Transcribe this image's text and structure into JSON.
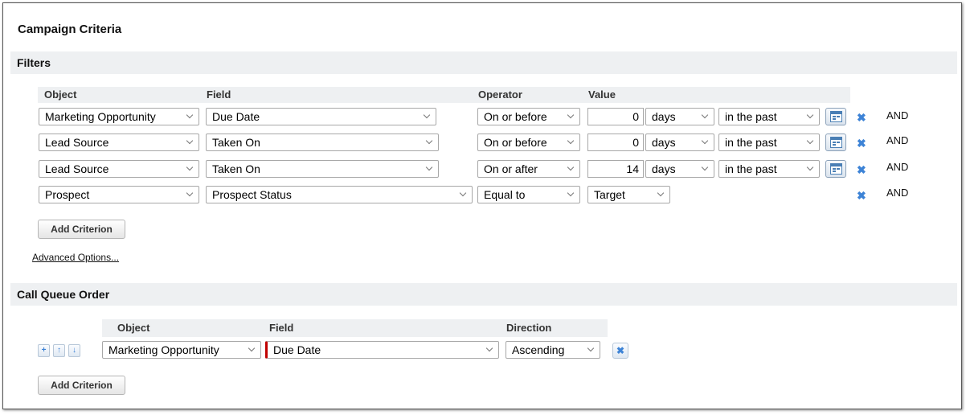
{
  "title": "Campaign Criteria",
  "filters": {
    "section_label": "Filters",
    "headers": {
      "object": "Object",
      "field": "Field",
      "operator": "Operator",
      "value": "Value"
    },
    "rows": [
      {
        "object": "Marketing Opportunity",
        "field": "Due Date",
        "operator": "On or before",
        "amount": "0",
        "unit": "days",
        "timeframe": "in the past",
        "logic": "AND"
      },
      {
        "object": "Lead Source",
        "field": "Taken On",
        "operator": "On or before",
        "amount": "0",
        "unit": "days",
        "timeframe": "in the past",
        "logic": "AND"
      },
      {
        "object": "Lead Source",
        "field": "Taken On",
        "operator": "On or after",
        "amount": "14",
        "unit": "days",
        "timeframe": "in the past",
        "logic": "AND"
      },
      {
        "object": "Prospect",
        "field": "Prospect Status",
        "operator": "Equal to",
        "value": "Target",
        "logic": "AND"
      }
    ],
    "add_criterion_label": "Add Criterion",
    "advanced_options_label": "Advanced Options..."
  },
  "call_queue": {
    "section_label": "Call Queue Order",
    "headers": {
      "object": "Object",
      "field": "Field",
      "direction": "Direction"
    },
    "row": {
      "object": "Marketing Opportunity",
      "field": "Due Date",
      "direction": "Ascending"
    },
    "add_criterion_label": "Add Criterion"
  },
  "icons": {
    "remove": "close-icon",
    "lookup": "calendar-lookup-icon",
    "add": "plus-icon",
    "up": "arrow-up-icon",
    "down": "arrow-down-icon"
  },
  "colors": {
    "accent": "#3d83d6",
    "required": "#c00000",
    "section_bg": "#eef0f2"
  }
}
